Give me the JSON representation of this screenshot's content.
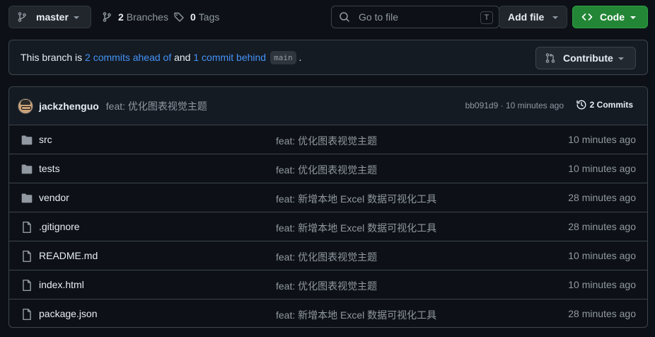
{
  "toolbar": {
    "branch": "master",
    "branches_count": "2",
    "branches_label": "Branches",
    "tags_count": "0",
    "tags_label": "Tags",
    "goto_placeholder": "Go to file",
    "goto_shortcut": "T",
    "add_file_label": "Add file",
    "code_label": "Code"
  },
  "banner": {
    "prefix": "This branch is ",
    "ahead_link": "2 commits ahead of",
    "middle": " and ",
    "behind_link": "1 commit behind",
    "branch_code": "main",
    "suffix": " .",
    "contribute_label": "Contribute"
  },
  "latest_commit": {
    "author": "jackzhenguo",
    "message": "feat: 优化图表视觉主题",
    "meta": "bb091d9 · 10 minutes ago",
    "commits_label": "2 Commits"
  },
  "files": [
    {
      "name": "src",
      "type": "folder",
      "message": "feat: 优化图表视觉主题",
      "time": "10 minutes ago"
    },
    {
      "name": "tests",
      "type": "folder",
      "message": "feat: 优化图表视觉主题",
      "time": "10 minutes ago"
    },
    {
      "name": "vendor",
      "type": "folder",
      "message": "feat: 新增本地 Excel 数据可视化工具",
      "time": "28 minutes ago"
    },
    {
      "name": ".gitignore",
      "type": "file",
      "message": "feat: 新增本地 Excel 数据可视化工具",
      "time": "28 minutes ago"
    },
    {
      "name": "README.md",
      "type": "file",
      "message": "feat: 优化图表视觉主题",
      "time": "10 minutes ago"
    },
    {
      "name": "index.html",
      "type": "file",
      "message": "feat: 优化图表视觉主题",
      "time": "10 minutes ago"
    },
    {
      "name": "package.json",
      "type": "file",
      "message": "feat: 新增本地 Excel 数据可视化工具",
      "time": "28 minutes ago"
    }
  ],
  "colors": {
    "background": "#0d1117",
    "accent_link": "#4493f8",
    "code_button": "#238636"
  }
}
